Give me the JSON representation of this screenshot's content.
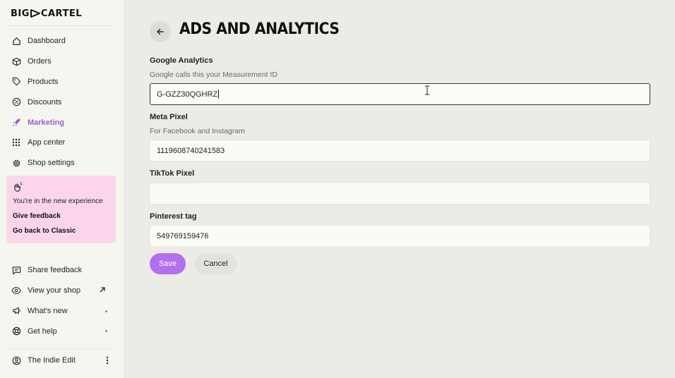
{
  "brand": {
    "name_left": "BIG",
    "name_right": "CARTEL"
  },
  "sidebar": {
    "items": [
      {
        "label": "Dashboard",
        "icon": "home-icon"
      },
      {
        "label": "Orders",
        "icon": "box-icon"
      },
      {
        "label": "Products",
        "icon": "tag-icon"
      },
      {
        "label": "Discounts",
        "icon": "discount-icon"
      },
      {
        "label": "Marketing",
        "icon": "rocket-icon",
        "active": true
      },
      {
        "label": "App center",
        "icon": "grid-icon"
      },
      {
        "label": "Shop settings",
        "icon": "gear-icon"
      }
    ],
    "promo": {
      "text": "You're in the new experience",
      "feedback": "Give feedback",
      "classic": "Go back to Classic"
    },
    "secondary": [
      {
        "label": "Share feedback",
        "icon": "chat-icon"
      },
      {
        "label": "View your shop",
        "icon": "eye-icon"
      },
      {
        "label": "What's new",
        "icon": "megaphone-icon"
      },
      {
        "label": "Get help",
        "icon": "lifebuoy-icon"
      }
    ],
    "account": {
      "label": "The Indie Edit",
      "icon": "user-icon"
    }
  },
  "page": {
    "title": "ADS AND ANALYTICS"
  },
  "form": {
    "google": {
      "label": "Google Analytics",
      "help": "Google calls this your Measurement ID",
      "value": "G-GZZ30QGHRZ"
    },
    "meta": {
      "label": "Meta Pixel",
      "help": "For Facebook and Instagram",
      "value": "1119608740241583"
    },
    "tiktok": {
      "label": "TikTok Pixel",
      "value": ""
    },
    "pinterest": {
      "label": "Pinterest tag",
      "value": "549769159476"
    },
    "save_label": "Save",
    "cancel_label": "Cancel"
  },
  "colors": {
    "accent": "#b36ff0",
    "active_nav": "#9a5ed4",
    "promo_bg": "#fbd6ea",
    "notification_dot": "#e25a7c"
  }
}
